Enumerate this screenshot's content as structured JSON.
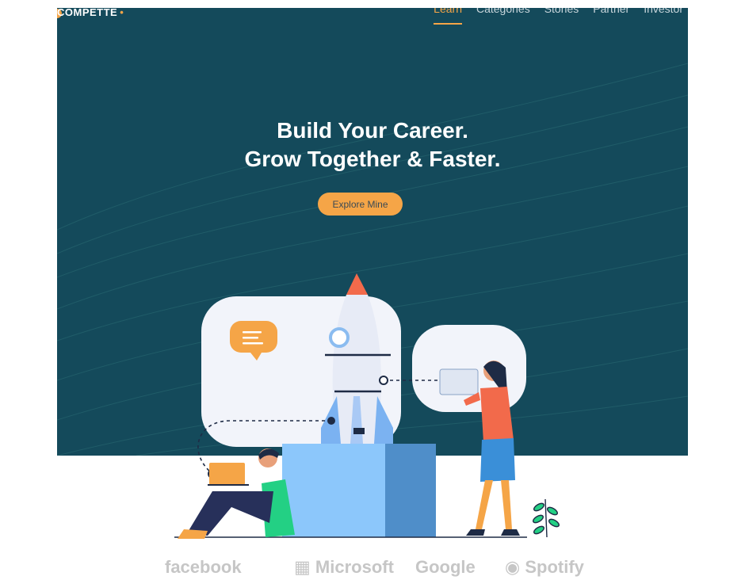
{
  "brand": {
    "logo_text": "COMPETTE",
    "accent_color": "#f5a547"
  },
  "nav": {
    "items": [
      {
        "label": "Learn",
        "active": true
      },
      {
        "label": "Categories",
        "active": false
      },
      {
        "label": "Stories",
        "active": false
      },
      {
        "label": "Partner",
        "active": false
      },
      {
        "label": "Investor",
        "active": false
      }
    ]
  },
  "hero": {
    "title_line1": "Build Your Career.",
    "title_line2": "Grow Together & Faster.",
    "cta_label": "Explore Mine",
    "background_color": "#144a5b"
  },
  "partners": {
    "logos": [
      "facebook",
      "Microsoft",
      "Google",
      "Spotify"
    ]
  }
}
